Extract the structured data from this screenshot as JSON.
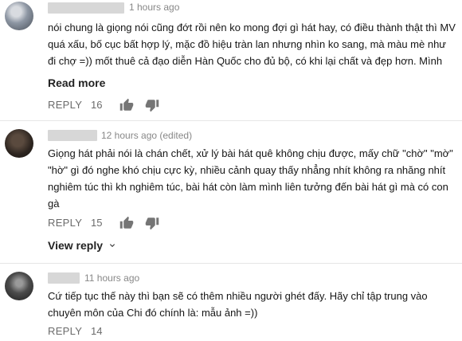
{
  "comments": [
    {
      "time": "1 hours ago",
      "text": "nói chung là giọng nói cũng đớt rồi nên ko mong đợi gì hát hay, có điều thành thật thì MV quá xấu, bố cục bất hợp lý, mặc đồ hiệu tràn lan nhưng nhìn ko sang, mà màu mè như đi chợ =)) mốt thuê cả đạo diễn Hàn Quốc cho đủ bộ, có khi lại chất và đẹp hơn. Mình thấy Chi đừng nên làm ca sĩ hay diễn viên vì Chi thực sự diễn rất dở, kể cả trong",
      "read_more": "Read more",
      "reply_label": "REPLY",
      "likes": "16"
    },
    {
      "time": "12 hours ago (edited)",
      "text": "Giọng hát phải nói là chán chết, xử lý bài hát quê không chịu được, mấy chữ \"chờ\" \"mờ\" \"hờ\" gì đó nghe khó chịu cực kỳ, nhiều cảnh quay thấy nhẳng nhít không ra nhăng nhít nghiêm túc thì kh nghiêm túc, bài hát còn làm mình liên tưởng đến bài hát gì mà có con gà",
      "reply_label": "REPLY",
      "likes": "15",
      "view_reply": "View reply"
    },
    {
      "time": "11 hours ago",
      "text": "Cứ tiếp tục thế này thì bạn sẽ có thêm nhiều người ghét đấy. Hãy chỉ tập trung vào chuyên môn của Chi đó chính là: mẫu ảnh =))",
      "reply_label": "REPLY",
      "likes": "14"
    }
  ],
  "icons": {
    "like": "thumbs-up-icon",
    "dislike": "thumbs-down-icon",
    "expand": "chevron-down-icon"
  }
}
